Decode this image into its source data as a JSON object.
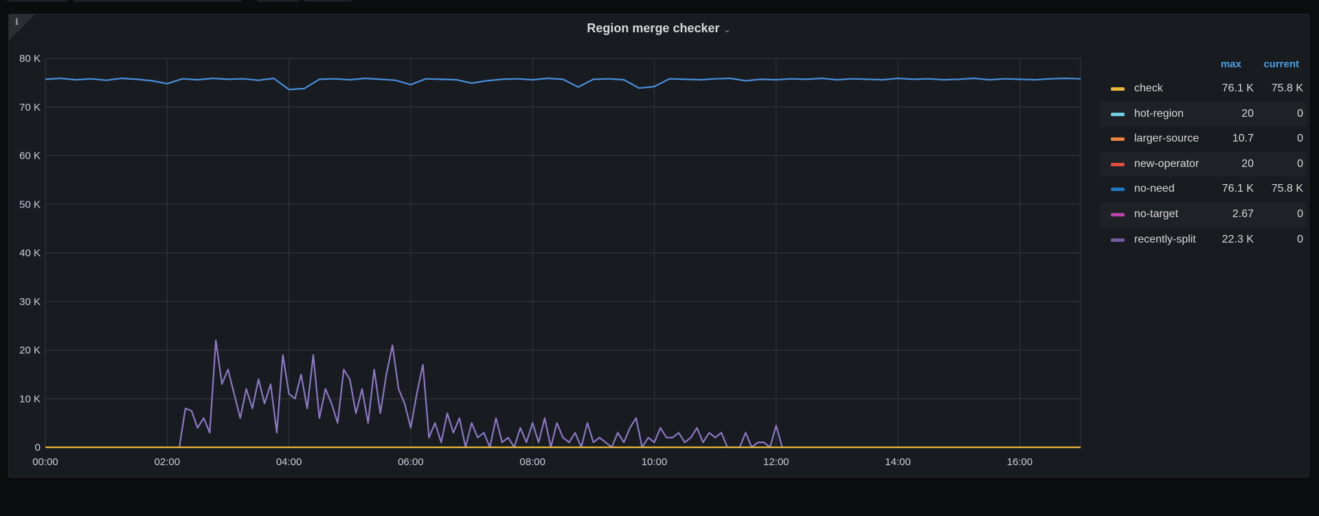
{
  "panel": {
    "title": "Region merge checker",
    "info_icon": "i"
  },
  "legend": {
    "headers": {
      "max": "max",
      "current": "current"
    },
    "items": [
      {
        "name": "check",
        "color": "#eab839",
        "max": "76.1 K",
        "current": "75.8 K"
      },
      {
        "name": "hot-region",
        "color": "#6ed0e0",
        "max": "20",
        "current": "0"
      },
      {
        "name": "larger-source",
        "color": "#ef843c",
        "max": "10.7",
        "current": "0"
      },
      {
        "name": "new-operator",
        "color": "#e24d42",
        "max": "20",
        "current": "0"
      },
      {
        "name": "no-need",
        "color": "#1f78c1",
        "max": "76.1 K",
        "current": "75.8 K"
      },
      {
        "name": "no-target",
        "color": "#ba43a9",
        "max": "2.67",
        "current": "0"
      },
      {
        "name": "recently-split",
        "color": "#705da0",
        "max": "22.3 K",
        "current": "0"
      }
    ]
  },
  "chart_data": {
    "type": "line",
    "title": "Region merge checker",
    "xlabel": "",
    "ylabel": "",
    "xlim": [
      0,
      17
    ],
    "ylim": [
      0,
      80
    ],
    "x_unit": "hours",
    "y_unit": "K",
    "grid": true,
    "legend_placement": "right",
    "yticks": [
      "0",
      "10 K",
      "20 K",
      "30 K",
      "40 K",
      "50 K",
      "60 K",
      "70 K",
      "80 K"
    ],
    "ytick_values": [
      0,
      10,
      20,
      30,
      40,
      50,
      60,
      70,
      80
    ],
    "xticks": [
      "00:00",
      "02:00",
      "04:00",
      "06:00",
      "08:00",
      "10:00",
      "12:00",
      "14:00",
      "16:00"
    ],
    "xtick_values": [
      0,
      2,
      4,
      6,
      8,
      10,
      12,
      14,
      16
    ],
    "series": [
      {
        "name": "check",
        "color": "#eab839",
        "x_start": 0,
        "x_step": 17,
        "values": [
          0,
          0
        ]
      },
      {
        "name": "no-need",
        "color": "#4a8fdc",
        "x_start": 0,
        "x_step": 0.25,
        "values": [
          75.7,
          75.9,
          75.6,
          75.8,
          75.5,
          75.9,
          75.7,
          75.4,
          74.8,
          75.8,
          75.6,
          75.9,
          75.7,
          75.8,
          75.5,
          75.9,
          73.6,
          73.8,
          75.7,
          75.8,
          75.6,
          75.9,
          75.7,
          75.5,
          74.6,
          75.8,
          75.7,
          75.6,
          74.9,
          75.4,
          75.7,
          75.8,
          75.6,
          75.9,
          75.7,
          74.1,
          75.7,
          75.8,
          75.6,
          73.9,
          74.2,
          75.8,
          75.7,
          75.6,
          75.8,
          75.9,
          75.4,
          75.7,
          75.6,
          75.8,
          75.7,
          75.9,
          75.6,
          75.8,
          75.7,
          75.6,
          75.9,
          75.7,
          75.8,
          75.6,
          75.7,
          75.9,
          75.6,
          75.8,
          75.7,
          75.6,
          75.8,
          75.9,
          75.8
        ]
      },
      {
        "name": "recently-split",
        "color": "#8c78c8",
        "x_start": 2.2,
        "x_step": 0.1,
        "values": [
          0,
          8,
          7.5,
          4,
          6,
          3,
          22,
          13,
          16,
          11,
          6,
          12,
          8,
          14,
          9,
          13,
          3,
          19,
          11,
          10,
          15,
          8,
          19,
          6,
          12,
          9,
          5,
          16,
          14,
          7,
          12,
          5,
          16,
          7,
          15,
          21,
          12,
          9,
          4,
          11,
          17,
          2,
          5,
          1,
          7,
          3,
          6,
          0,
          5,
          2,
          3,
          0,
          6,
          1,
          2,
          0,
          4,
          1,
          5,
          1,
          6,
          0,
          5,
          2,
          1,
          3,
          0,
          5,
          1,
          2,
          1,
          0,
          3,
          1,
          4,
          6,
          0,
          2,
          1,
          4,
          2,
          2,
          3,
          1,
          2,
          4,
          1,
          3,
          2,
          3,
          0,
          0,
          0,
          3,
          0,
          1,
          1,
          0,
          4.5,
          0
        ]
      }
    ]
  }
}
